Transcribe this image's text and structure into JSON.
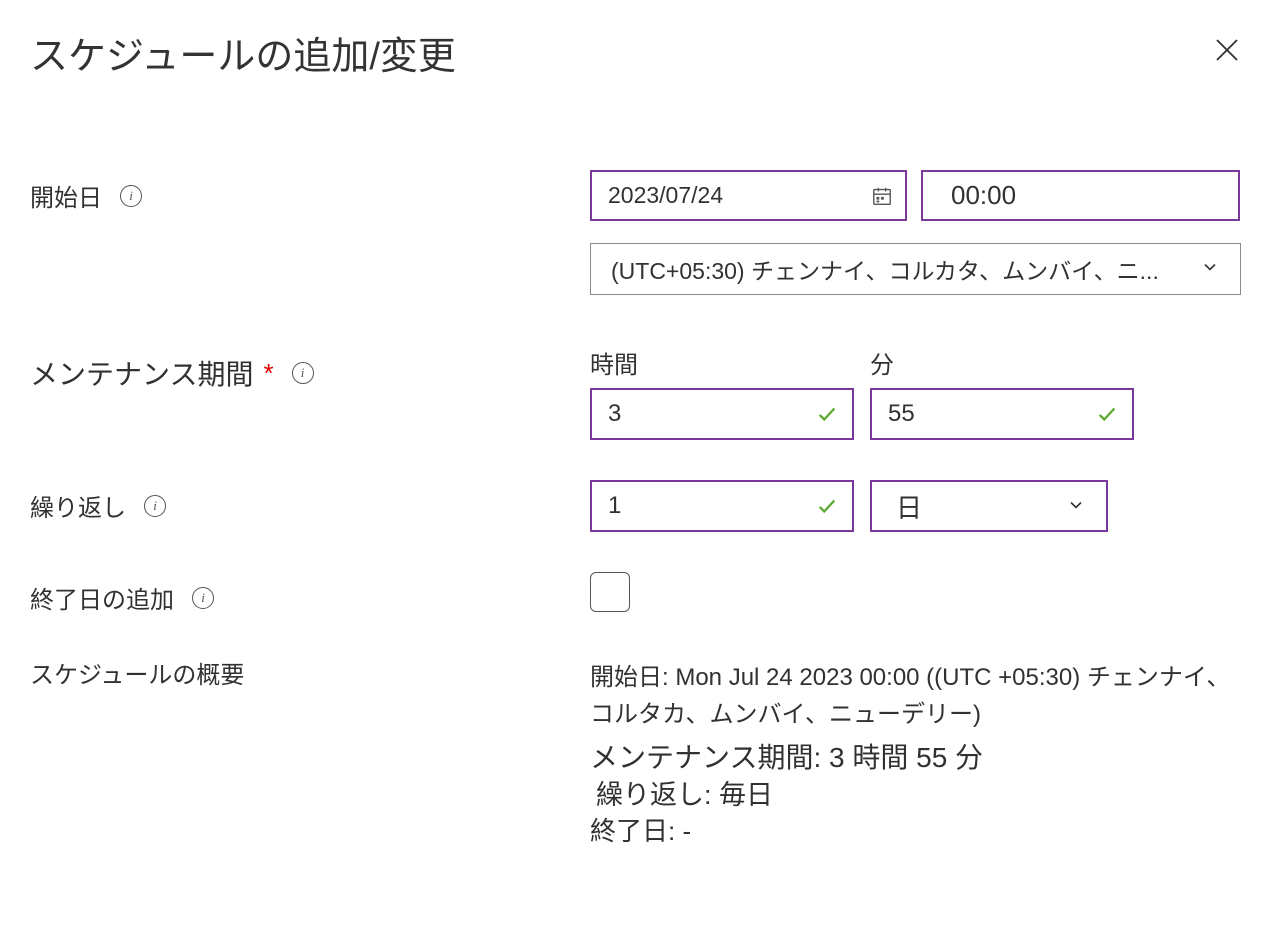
{
  "header": {
    "title": "スケジュールの追加/変更"
  },
  "labels": {
    "start_date": "開始日",
    "maint_window": "メンテナンス期間",
    "hours": "時間",
    "minutes": "分",
    "repeat": "繰り返し",
    "add_end_date": "終了日の追加",
    "summary": "スケジュールの概要"
  },
  "values": {
    "date": "2023/07/24",
    "time": "00:00",
    "timezone": "(UTC+05:30) チェンナイ、コルカタ、ムンバイ、ニ...",
    "hours": "3",
    "minutes": "55",
    "repeat_count": "1",
    "repeat_unit": "日"
  },
  "summary": {
    "line1": "開始日: Mon Jul 24 2023 00:00 ((UTC +05:30) チェンナイ、コルタカ、ムンバイ、ニューデリー)",
    "line2": "メンテナンス期間: 3 時間 55 分",
    "line3": "繰り返し: 毎日",
    "line4": "終了日: -"
  }
}
